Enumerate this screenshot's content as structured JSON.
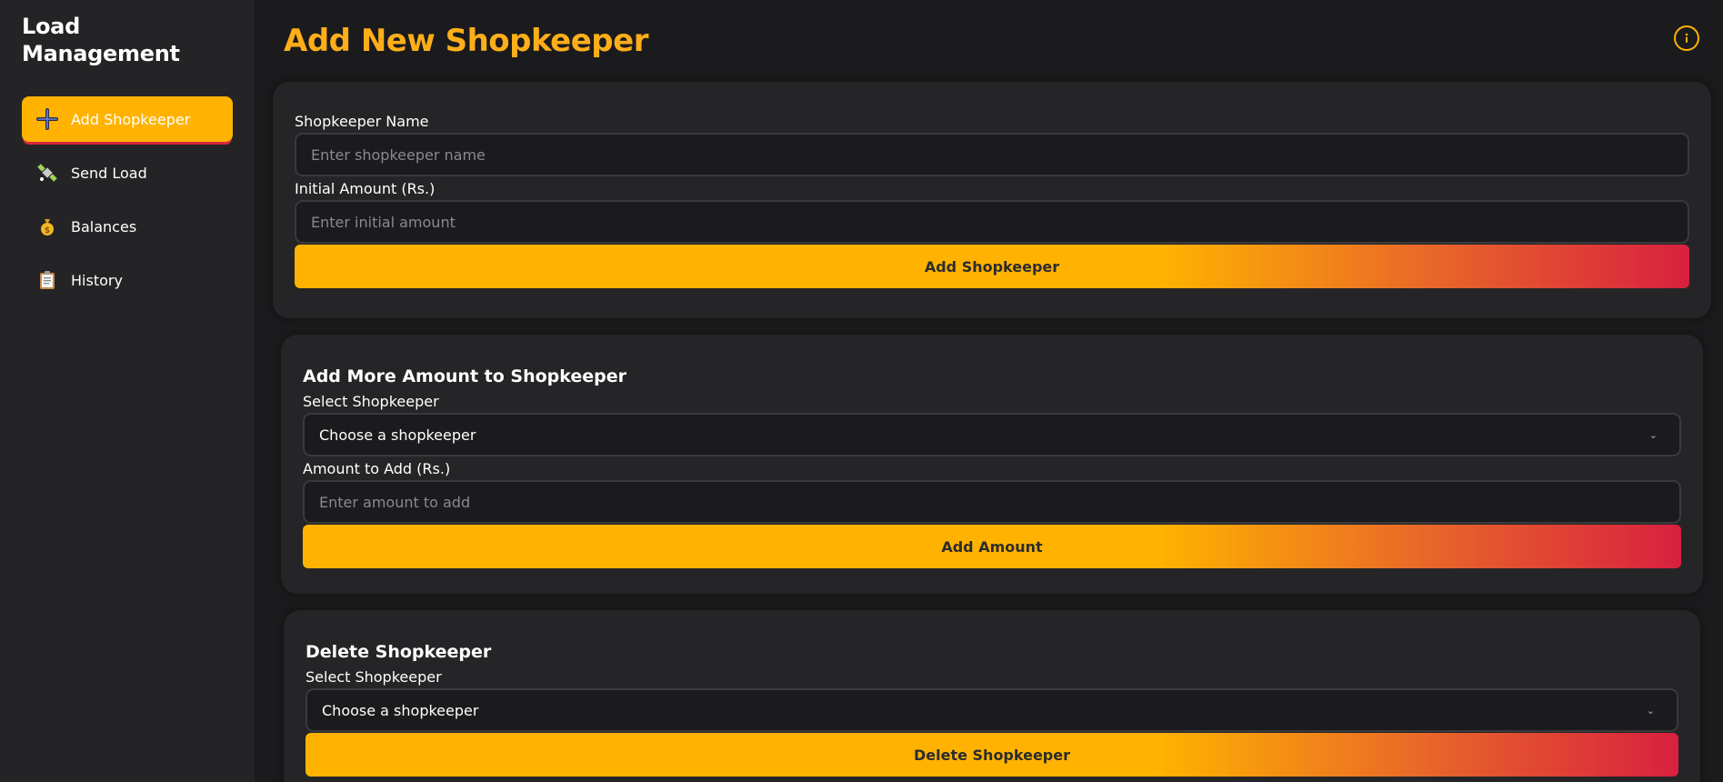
{
  "sidebar": {
    "brand": "Load Management",
    "items": [
      {
        "label": "Add Shopkeeper",
        "icon": "plus-icon",
        "active": true
      },
      {
        "label": "Send Load",
        "icon": "satellite-icon"
      },
      {
        "label": "Balances",
        "icon": "money-bag-icon"
      },
      {
        "label": "History",
        "icon": "clipboard-icon"
      }
    ]
  },
  "main": {
    "title": "Add New Shopkeeper",
    "info_icon": "info-icon",
    "add_card": {
      "name_label": "Shopkeeper Name",
      "name_placeholder": "Enter shopkeeper name",
      "amount_label": "Initial Amount (Rs.)",
      "amount_placeholder": "Enter initial amount",
      "button": "Add Shopkeeper"
    },
    "add_amount_card": {
      "heading": "Add More Amount to Shopkeeper",
      "select_label": "Select Shopkeeper",
      "select_value": "Choose a shopkeeper",
      "amount_label": "Amount to Add (Rs.)",
      "amount_placeholder": "Enter amount to add",
      "button": "Add Amount"
    },
    "delete_card": {
      "heading": "Delete Shopkeeper",
      "select_label": "Select Shopkeeper",
      "select_value": "Choose a shopkeeper",
      "button": "Delete Shopkeeper"
    }
  },
  "colors": {
    "accent": "#ffb300",
    "accent_end": "#d8203f",
    "background": "#1b1b1d",
    "sidebar": "#242426",
    "card": "#252527"
  }
}
